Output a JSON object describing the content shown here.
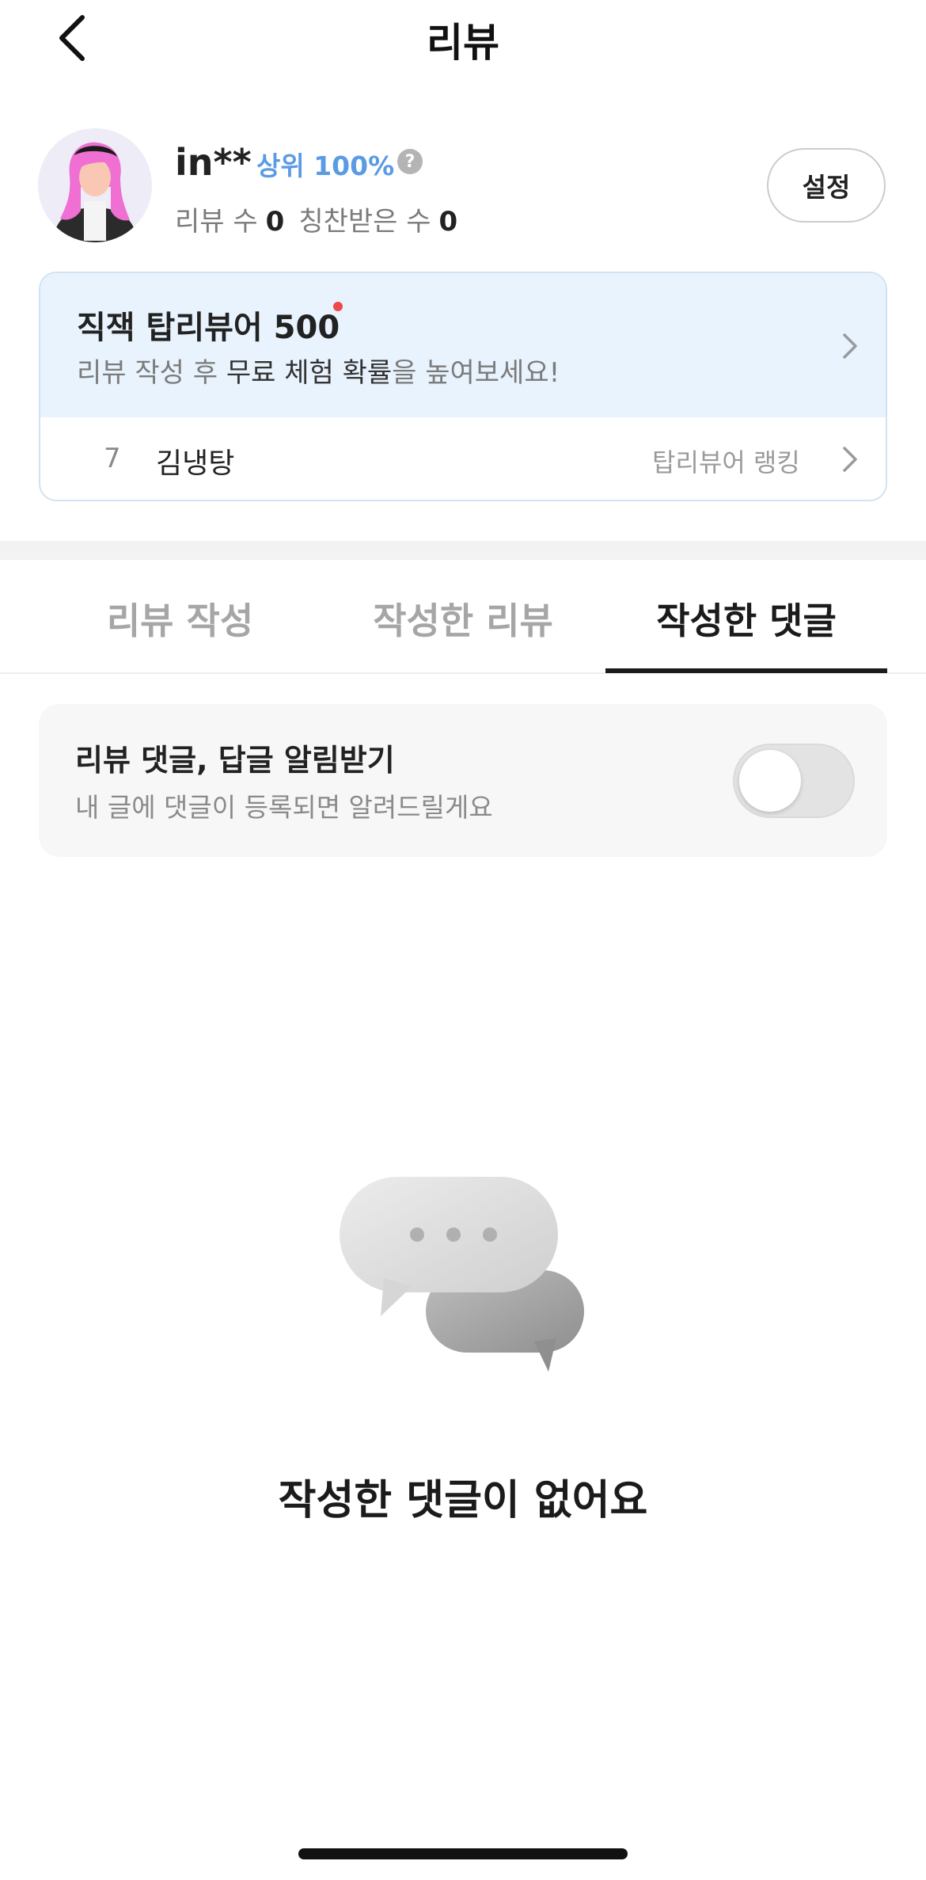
{
  "header": {
    "title": "리뷰",
    "back_icon": "chevron-left-icon"
  },
  "profile": {
    "username": "in**",
    "rank_badge": "상위 100%",
    "help_icon_text": "?",
    "review_count_label": "리뷰 수",
    "review_count_value": "0",
    "praise_count_label": "칭찬받은 수",
    "praise_count_value": "0",
    "settings_label": "설정"
  },
  "top_reviewer_card": {
    "title": "직잭 탑리뷰어 500",
    "desc_pre": "리뷰 작성 후 ",
    "desc_bold": "무료 체험 확률",
    "desc_post": "을 높여보세요!",
    "rank_number": "7",
    "rank_name": "김냉탕",
    "rank_link_label": "탑리뷰어 랭킹"
  },
  "tabs": [
    {
      "label": "리뷰 작성",
      "active": false
    },
    {
      "label": "작성한 리뷰",
      "active": false
    },
    {
      "label": "작성한 댓글",
      "active": true
    }
  ],
  "notification": {
    "title": "리뷰 댓글, 답글 알림받기",
    "description": "내 글에 댓글이 등록되면 알려드릴게요",
    "toggle_on": false
  },
  "empty_state": {
    "icon": "chat-bubbles-icon",
    "message": "작성한 댓글이 없어요"
  },
  "colors": {
    "accent_blue": "#5b9be4",
    "card_bg": "#e8f3fd",
    "new_dot": "#f0474b"
  }
}
